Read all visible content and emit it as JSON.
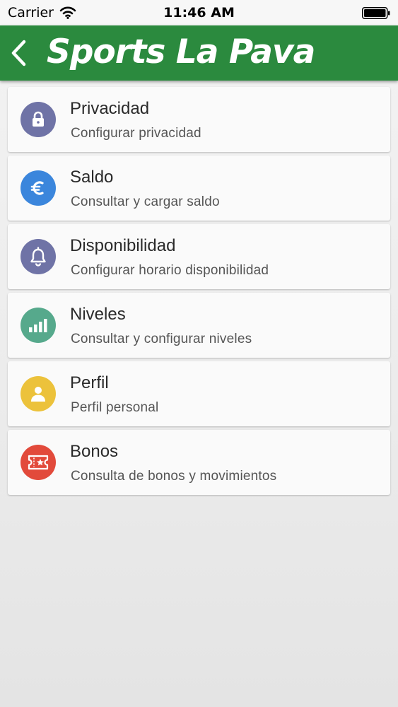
{
  "status_bar": {
    "carrier": "Carrier",
    "time": "11:46 AM"
  },
  "header": {
    "title": "Sports La Pava",
    "background": "#2b8a3e"
  },
  "menu": {
    "items": [
      {
        "title": "Privacidad",
        "subtitle": "Configurar privacidad",
        "icon": "lock-icon",
        "color": "#6f73a6"
      },
      {
        "title": "Saldo",
        "subtitle": "Consultar y cargar saldo",
        "icon": "euro-icon",
        "color": "#3b86dc"
      },
      {
        "title": "Disponibilidad",
        "subtitle": "Configurar horario disponibilidad",
        "icon": "bell-icon",
        "color": "#6f73a6"
      },
      {
        "title": "Niveles",
        "subtitle": "Consultar y configurar niveles",
        "icon": "signal-bars-icon",
        "color": "#56a98c"
      },
      {
        "title": "Perfil",
        "subtitle": "Perfil personal",
        "icon": "user-icon",
        "color": "#ecc23b"
      },
      {
        "title": "Bonos",
        "subtitle": "Consulta de bonos y movimientos",
        "icon": "ticket-icon",
        "color": "#e24a3b"
      }
    ]
  }
}
